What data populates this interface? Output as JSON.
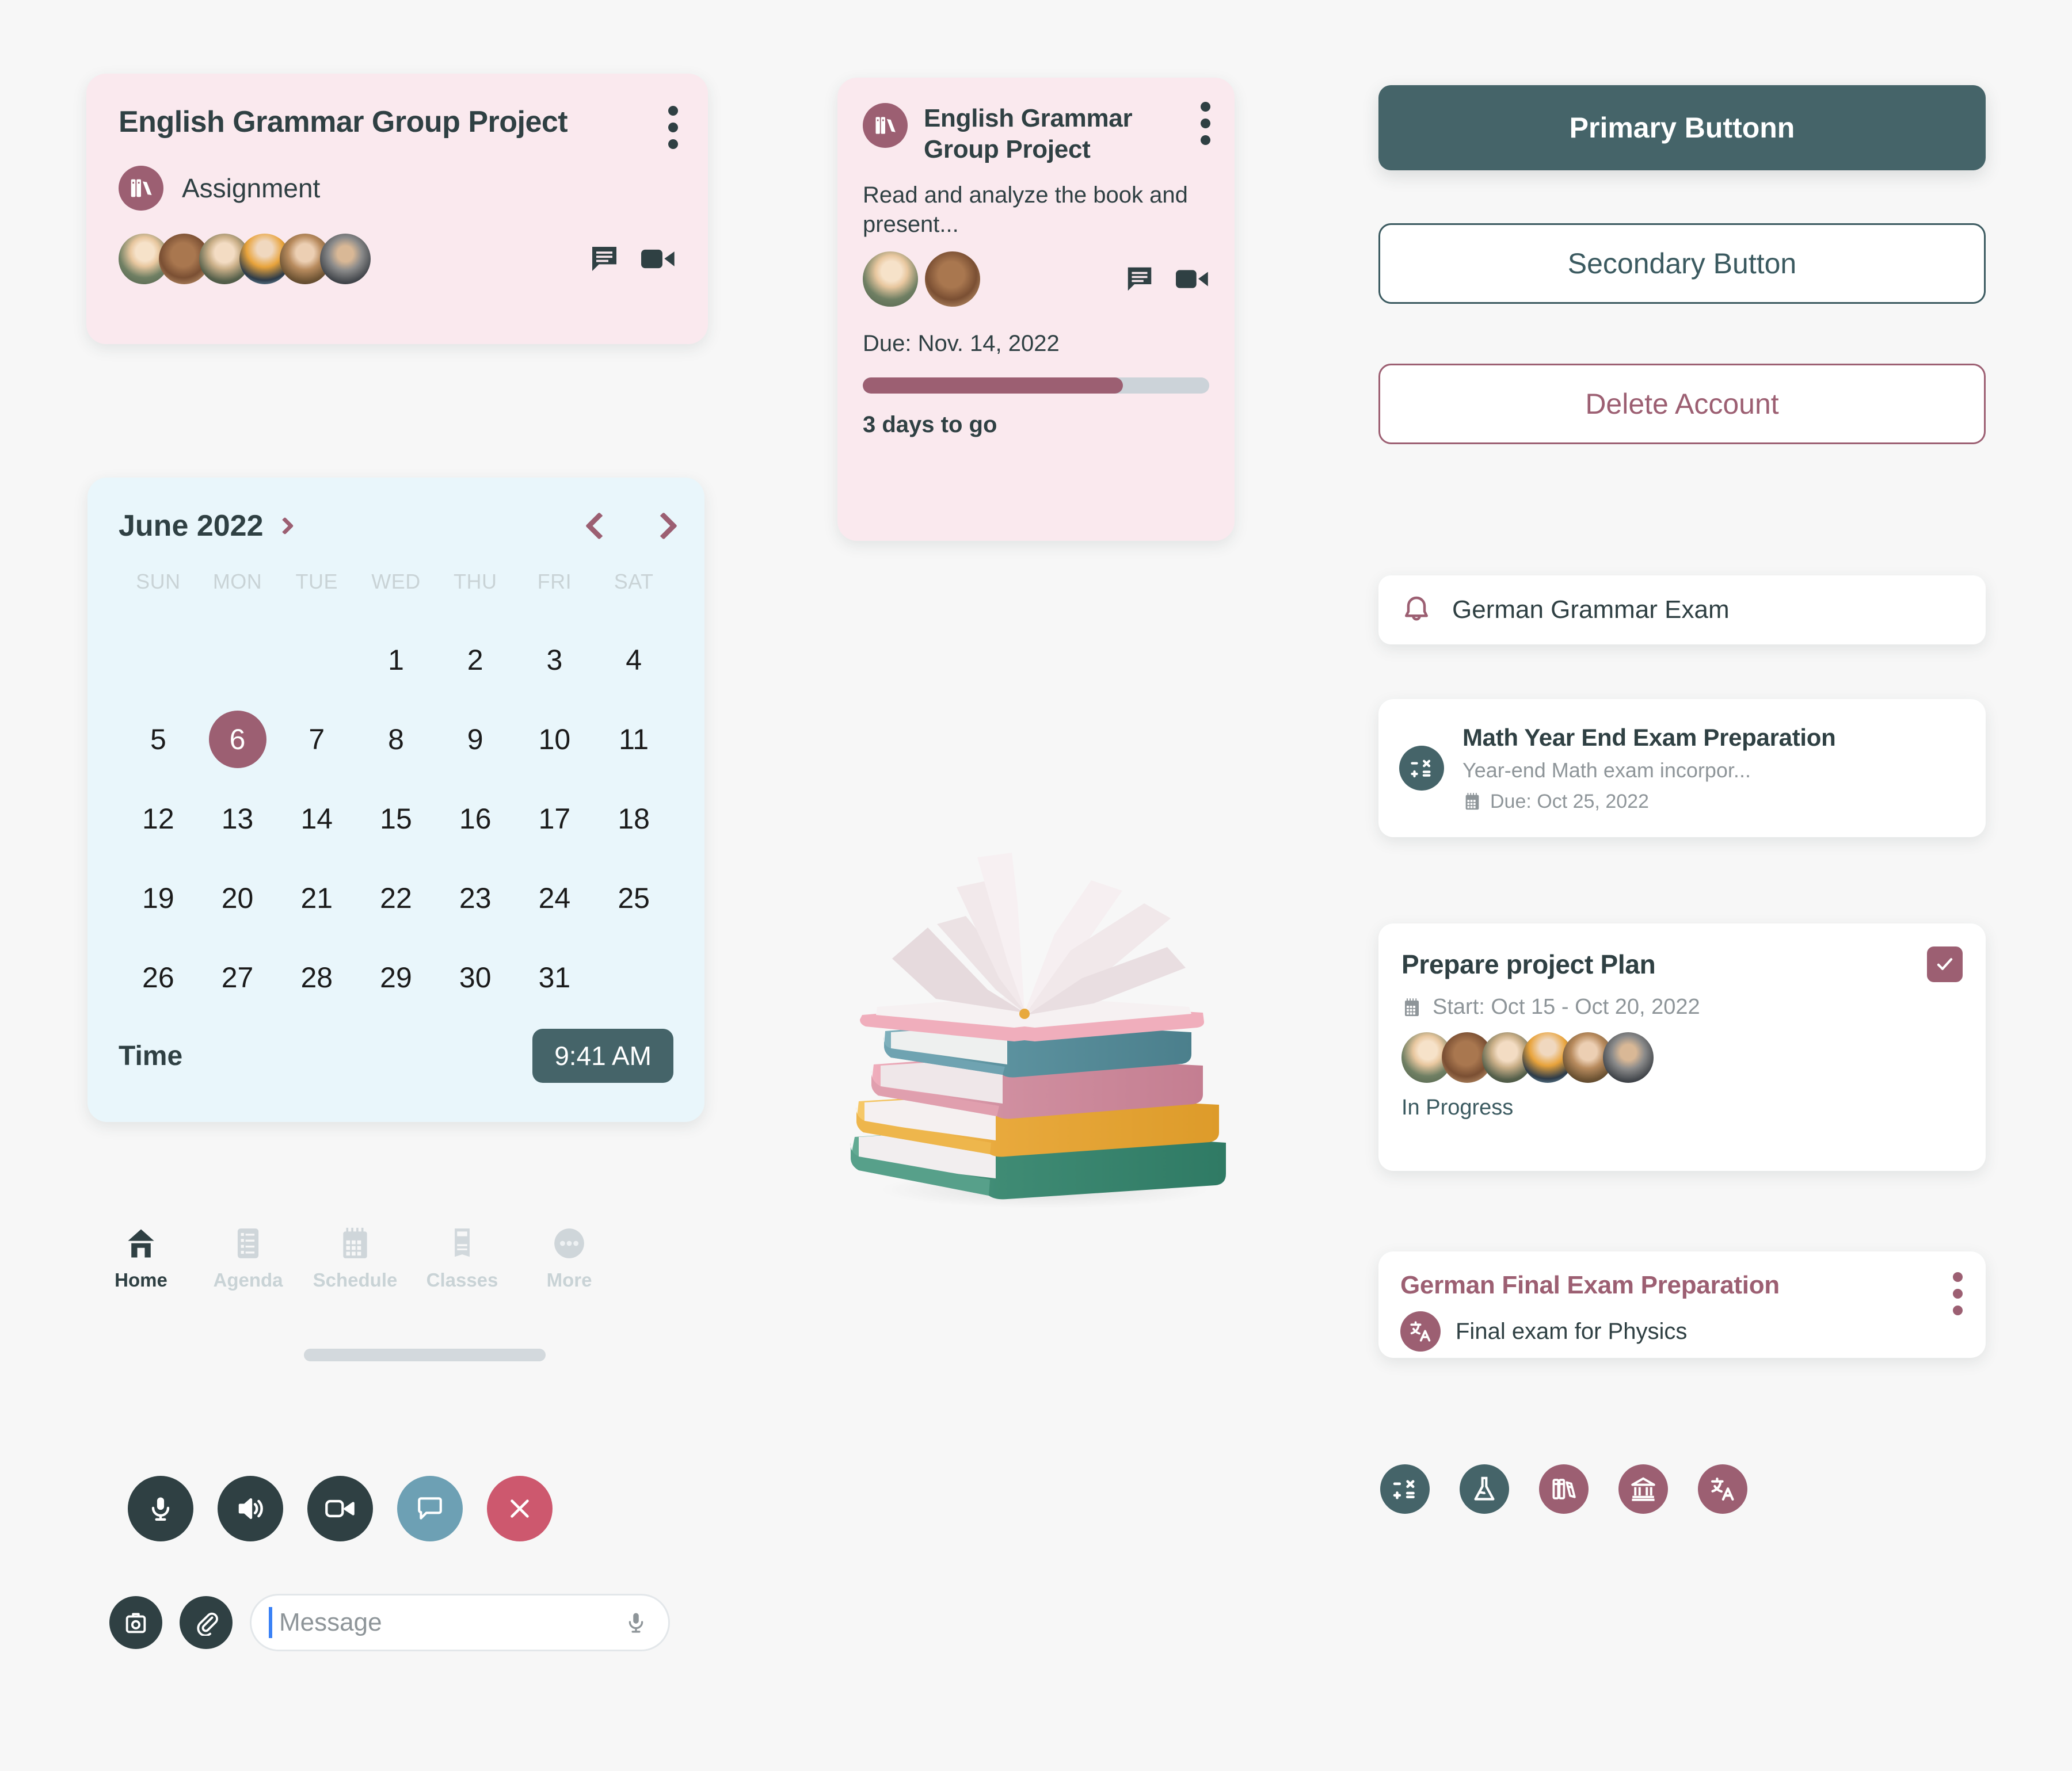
{
  "theme": {
    "background": "#f7f7f7",
    "pink_card": "#fae9ee",
    "calendar_card": "#e9f6fb",
    "mauve": "#9c5f72",
    "teal": "#456469",
    "dark_slate": "#2f4043",
    "blue_chat": "#6da0b4",
    "red_end": "#cd586e",
    "muted": "#8e9599"
  },
  "assignment_card": {
    "title": "English Grammar Group Project",
    "type_icon": "books-icon",
    "type_label": "Assignment",
    "member_count": 6,
    "chat_icon": "chat-icon",
    "video_icon": "video-camera-icon",
    "menu_icon": "kebab-menu-icon"
  },
  "detail_card": {
    "icon": "books-icon",
    "title": "English Grammar Group Project",
    "description": "Read and analyze the book and present...",
    "member_count": 2,
    "chat_icon": "chat-icon",
    "video_icon": "video-camera-icon",
    "menu_icon": "kebab-menu-icon",
    "due_label": "Due: Nov. 14, 2022",
    "progress_percent": 75,
    "countdown": "3 days to go"
  },
  "calendar": {
    "month_label": "June 2022",
    "expand_icon": "chevron-right-icon",
    "prev_icon": "chevron-left-icon",
    "next_icon": "chevron-right-icon",
    "weekday_headers": [
      "SUN",
      "MON",
      "TUE",
      "WED",
      "THU",
      "FRI",
      "SAT"
    ],
    "leading_blanks": 3,
    "days": [
      1,
      2,
      3,
      4,
      5,
      6,
      7,
      8,
      9,
      10,
      11,
      12,
      13,
      14,
      15,
      16,
      17,
      18,
      19,
      20,
      21,
      22,
      23,
      24,
      25,
      26,
      27,
      28,
      29,
      30,
      31
    ],
    "selected_day": 6,
    "time_label": "Time",
    "time_value": "9:41 AM"
  },
  "bottom_nav": {
    "items": [
      {
        "label": "Home",
        "icon": "home-icon",
        "active": true
      },
      {
        "label": "Agenda",
        "icon": "agenda-icon",
        "active": false
      },
      {
        "label": "Schedule",
        "icon": "schedule-icon",
        "active": false
      },
      {
        "label": "Classes",
        "icon": "classes-icon",
        "active": false
      },
      {
        "label": "More",
        "icon": "more-icon",
        "active": false
      }
    ]
  },
  "call_controls": [
    {
      "icon": "microphone-icon",
      "style": "dark"
    },
    {
      "icon": "speaker-icon",
      "style": "dark"
    },
    {
      "icon": "video-camera-icon",
      "style": "dark"
    },
    {
      "icon": "chat-bubble-icon",
      "style": "blue"
    },
    {
      "icon": "end-call-x-icon",
      "style": "red"
    }
  ],
  "message_bar": {
    "camera_icon": "camera-icon",
    "attach_icon": "paperclip-icon",
    "placeholder": "Message",
    "mic_icon": "microphone-icon"
  },
  "buttons": {
    "primary": "Primary Buttonn",
    "secondary": "Secondary Button",
    "delete": "Delete Account"
  },
  "reminder": {
    "icon": "bell-icon",
    "label": "German Grammar Exam"
  },
  "math_card": {
    "icon": "calculator-icon",
    "title": "Math Year End Exam Preparation",
    "subtitle": "Year-end Math exam incorpor...",
    "due_icon": "calendar-icon",
    "due_label": "Due: Oct 25, 2022"
  },
  "plan_card": {
    "title": "Prepare project Plan",
    "checkbox_icon": "checkmark-icon",
    "checked": true,
    "date_icon": "calendar-icon",
    "date_label": "Start: Oct 15 - Oct 20, 2022",
    "member_count": 6,
    "status": "In Progress"
  },
  "final_card": {
    "title": "German Final Exam Preparation",
    "menu_icon": "kebab-menu-icon",
    "subject_icon": "translate-icon",
    "subtitle": "Final exam for Physics"
  },
  "subject_icons": [
    {
      "name": "calculator-icon",
      "color": "#456469"
    },
    {
      "name": "flask-icon",
      "color": "#456469"
    },
    {
      "name": "books-icon",
      "color": "#9c5f72"
    },
    {
      "name": "bank-icon",
      "color": "#9c5f72"
    },
    {
      "name": "translate-icon",
      "color": "#9c5f72"
    }
  ],
  "illustration": {
    "name": "stacked-books-illustration",
    "book_colors": [
      "#d9909f",
      "#5d93a0",
      "#c97e91",
      "#e8a93c",
      "#3f8b74"
    ]
  }
}
